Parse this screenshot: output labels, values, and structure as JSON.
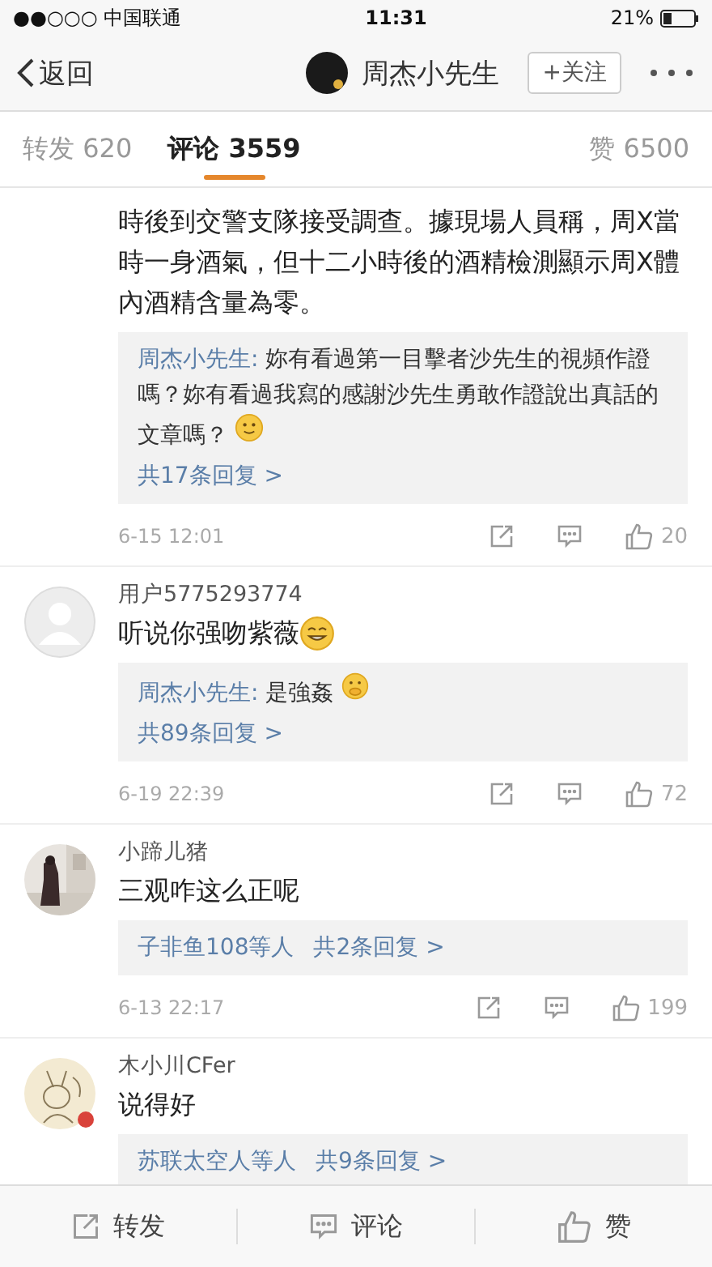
{
  "status_bar": {
    "carrier": "●●○○○ 中国联通",
    "time": "11:31",
    "battery": "21%"
  },
  "nav": {
    "back": "返回",
    "user": "周杰小先生",
    "follow": "+关注"
  },
  "tabs": [
    {
      "label": "转发 620",
      "selected": false
    },
    {
      "label": "评论 3559",
      "selected": true
    },
    {
      "label": "赞 6500",
      "selected": false
    }
  ],
  "comments": [
    {
      "text": "時後到交警支隊接受調查。據現場人員稱，周X當時一身酒氣，但十二小時後的酒精檢測顯示周X體內酒精含量為零。",
      "reply": {
        "kind": "quote",
        "author": "周杰小先生:",
        "text": "妳有看過第一目擊者沙先生的視頻作證嗎？妳有看過我寫的感謝沙先生勇敢作證說出真話的文章嗎？",
        "emoji": {
          "kind": "smile"
        },
        "more": "共17条回复 >"
      },
      "time": "6-15 12:01",
      "likes": "20"
    },
    {
      "avatar": {
        "kind": "default"
      },
      "name": "用户5775293774",
      "text": "听说你强吻紫薇",
      "emoji": {
        "kind": "grin"
      },
      "reply": {
        "kind": "quote",
        "author": "周杰小先生:",
        "text": "是強姦",
        "emoji": {
          "kind": "hush"
        },
        "more": "共89条回复 >"
      },
      "time": "6-19 22:39",
      "likes": "72"
    },
    {
      "name": "小蹄儿猪",
      "text": "三观咋这么正呢",
      "reply": {
        "kind": "summary",
        "author": "子非鱼108等人",
        "more": "共2条回复 >"
      },
      "time": "6-13 22:17",
      "likes": "199"
    },
    {
      "avatar": {
        "kind": "sketch"
      },
      "name": "木小川CFer",
      "text": "说得好",
      "reply": {
        "kind": "summary",
        "author": "苏联太空人等人",
        "more": "共9条回复 >"
      }
    }
  ],
  "bottom_bar": [
    "转发",
    "评论",
    "赞"
  ]
}
